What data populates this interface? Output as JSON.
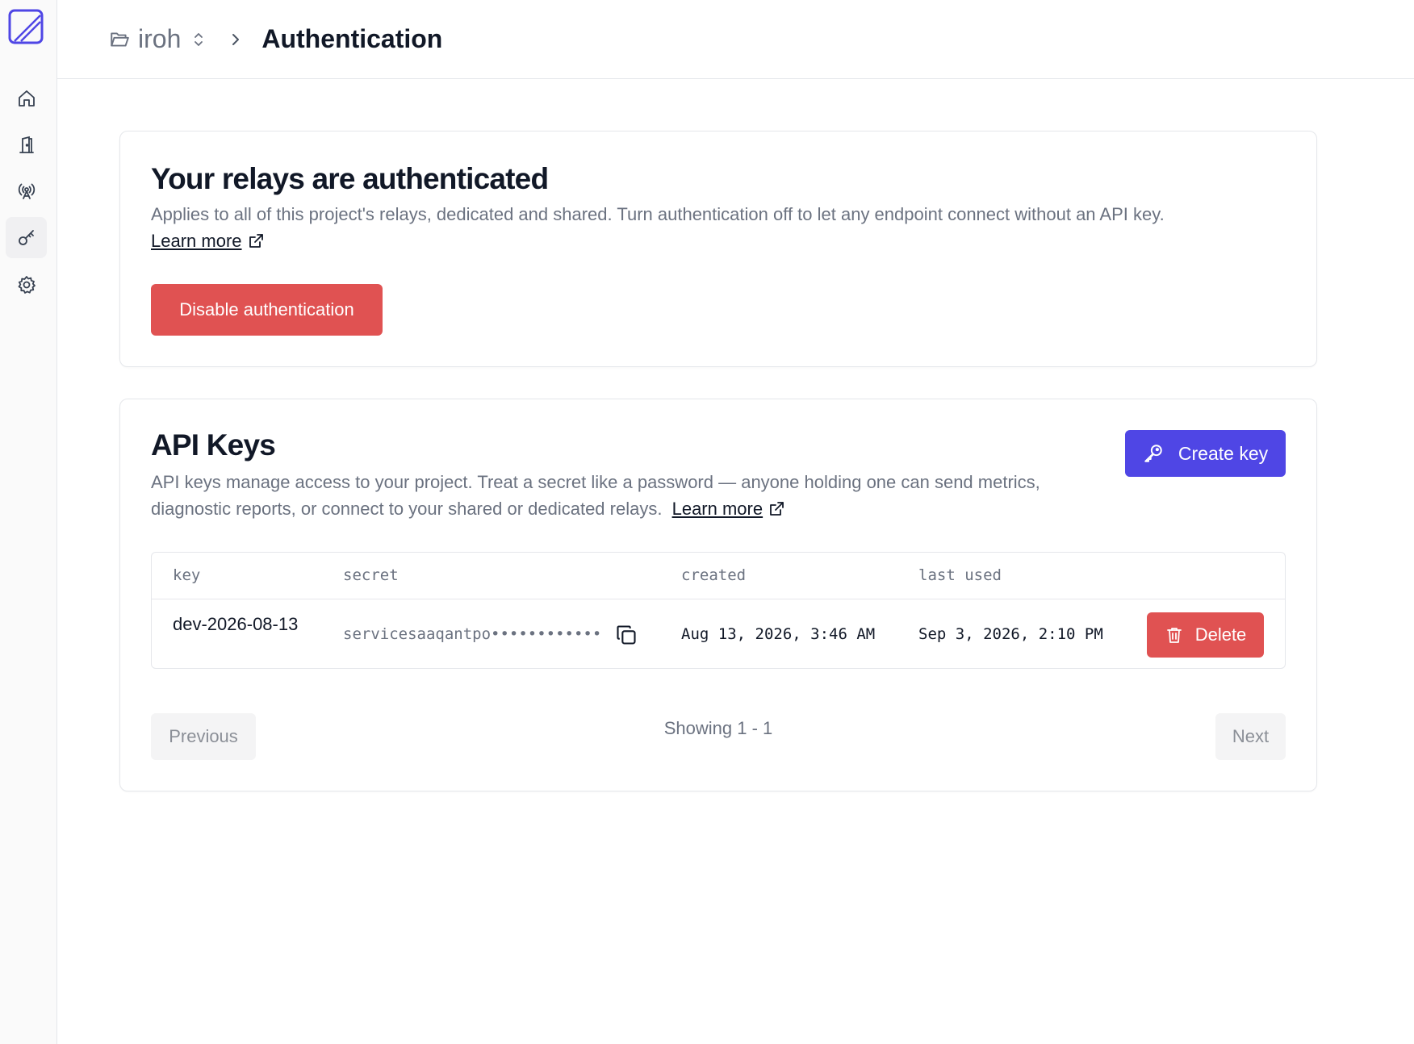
{
  "sidebar": {
    "items": [
      {
        "name": "home",
        "icon": "home-icon"
      },
      {
        "name": "door",
        "icon": "door-icon"
      },
      {
        "name": "relays",
        "icon": "broadcast-tower-icon"
      },
      {
        "name": "authentication",
        "icon": "key-icon",
        "active": true
      },
      {
        "name": "settings",
        "icon": "gear-icon"
      }
    ]
  },
  "header": {
    "project": "iroh",
    "title": "Authentication"
  },
  "auth_card": {
    "title": "Your relays are authenticated",
    "description": "Applies to all of this project's relays, dedicated and shared. Turn authentication off to let any endpoint connect without an API key.",
    "learn_more": "Learn more",
    "disable_button": "Disable authentication"
  },
  "api_keys": {
    "title": "API Keys",
    "description_line1": "API keys manage access to your project. Treat a secret like a password — anyone holding one can send metrics,",
    "description_line2": "diagnostic reports, or connect to your shared or dedicated relays.",
    "learn_more": "Learn more",
    "create_button": "Create key",
    "columns": [
      "key",
      "secret",
      "created",
      "last used"
    ],
    "rows": [
      {
        "key": "dev-2026-08-13",
        "secret": "servicesaaqantpo••••••••••••",
        "created": "Aug 13, 2026, 3:46 AM",
        "last_used": "Sep 3, 2026, 2:10 PM",
        "delete_label": "Delete"
      }
    ],
    "pagination": {
      "previous": "Previous",
      "info": "Showing 1 - 1",
      "next": "Next"
    }
  },
  "colors": {
    "accent": "#4f46e5",
    "danger": "#e05252",
    "muted_text": "#6b7280"
  }
}
